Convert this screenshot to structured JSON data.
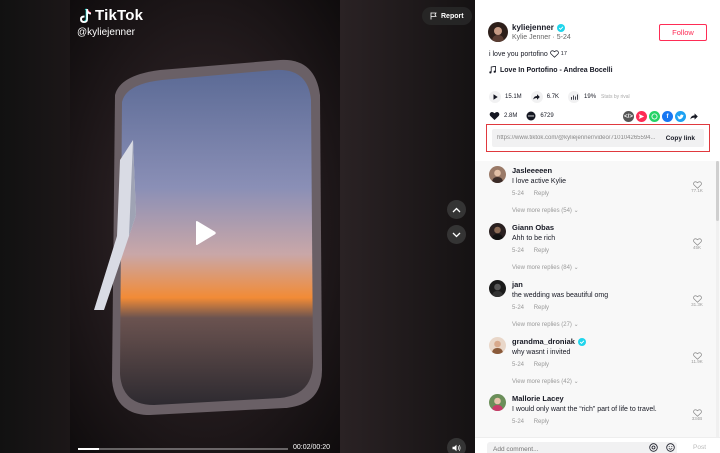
{
  "player": {
    "logo_text": "TikTok",
    "handle": "@kyliejenner",
    "report_label": "Report",
    "time": "00:02/00:20",
    "progress": 0.1
  },
  "author": {
    "username": "kyliejenner",
    "subline": "Kylie Jenner · 5-24",
    "verified": true
  },
  "follow_label": "Follow",
  "caption": "i love you portofino",
  "caption_suffix": "17",
  "music": "Love In Portofino - Andrea Bocelli",
  "stats": {
    "plays": "15.1M",
    "shares": "6.7K",
    "percent": "19%",
    "stitch": "Stats by rival"
  },
  "engagement": {
    "likes": "2.8M",
    "comments": "6729"
  },
  "share_icons": [
    "embed-icon",
    "friends-icon",
    "whatsapp-icon",
    "facebook-icon",
    "twitter-icon",
    "share-arrow-icon"
  ],
  "colors": {
    "accent": "#fe2c55",
    "highlight_box": "#e0393e",
    "whatsapp": "#25d366",
    "facebook": "#1877f2",
    "twitter": "#1da1f2",
    "friends": "#fe2c55",
    "embed": "#555555"
  },
  "link": {
    "url": "https://www.tiktok.com/@kyliejenner/video/710104265594...",
    "copy_label": "Copy link"
  },
  "comments": [
    {
      "name": "Jasleeeeen",
      "verified": false,
      "text": "I love active Kylie",
      "date": "5-24",
      "reply": "Reply",
      "more": "View more replies (54)",
      "likes": "77.1K"
    },
    {
      "name": "Giann Obas",
      "verified": false,
      "text": "Ahh to be rich",
      "date": "5-24",
      "reply": "Reply",
      "more": "View more replies (84)",
      "likes": "45K"
    },
    {
      "name": "jan",
      "verified": false,
      "text": "the wedding was beautiful omg",
      "date": "5-24",
      "reply": "Reply",
      "more": "View more replies (27)",
      "likes": "31.3K"
    },
    {
      "name": "grandma_droniak",
      "verified": true,
      "text": "why wasnt i invited",
      "date": "5-24",
      "reply": "Reply",
      "more": "View more replies (42)",
      "likes": "11.9K"
    },
    {
      "name": "Mallorie Lacey",
      "verified": false,
      "text": "I would only want the “rich” part of life to travel.",
      "date": "5-24",
      "reply": "Reply",
      "more": "",
      "likes": "334B"
    }
  ],
  "comment_input": {
    "placeholder": "Add comment...",
    "post_label": "Post"
  }
}
